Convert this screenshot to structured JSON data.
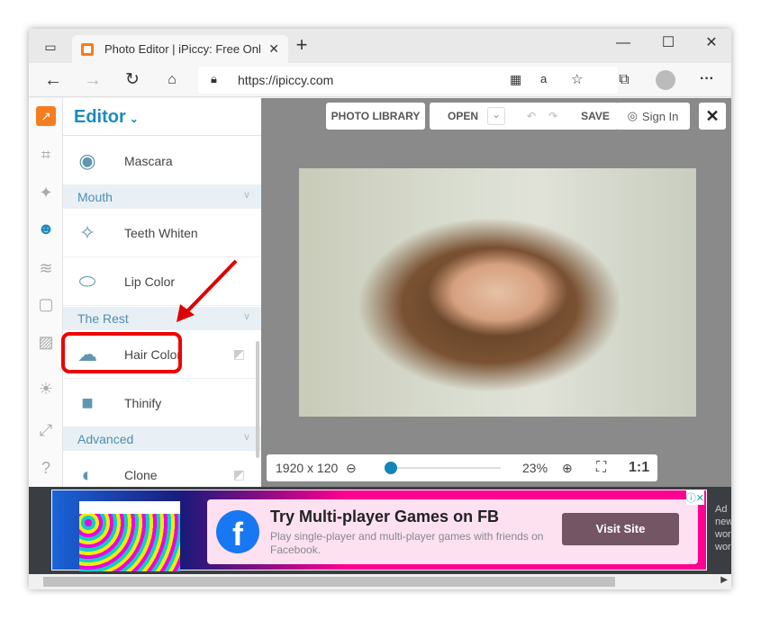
{
  "browser": {
    "tab_title": "Photo Editor | iPiccy: Free Online",
    "url": "https://ipiccy.com"
  },
  "editor": {
    "title": "Editor",
    "items": [
      {
        "type": "item",
        "label": "Mascara",
        "icon": "eye-icon"
      },
      {
        "type": "section",
        "label": "Mouth"
      },
      {
        "type": "item",
        "label": "Teeth Whiten",
        "icon": "tooth-icon"
      },
      {
        "type": "item",
        "label": "Lip Color",
        "icon": "lips-icon"
      },
      {
        "type": "section",
        "label": "The Rest"
      },
      {
        "type": "item",
        "label": "Hair Color",
        "icon": "hair-icon",
        "highlighted": true
      },
      {
        "type": "item",
        "label": "Thinify",
        "icon": "scale-icon"
      },
      {
        "type": "section",
        "label": "Advanced"
      },
      {
        "type": "item",
        "label": "Clone",
        "icon": "clone-icon"
      }
    ]
  },
  "toolbar": {
    "photo_library": "PHOTO LIBRARY",
    "open": "OPEN",
    "save": "SAVE",
    "sign_in": "Sign In"
  },
  "status": {
    "dimensions": "1920 x 120",
    "zoom": "23%",
    "zoom_fraction": 0.1,
    "one_to_one": "1:1"
  },
  "ad": {
    "title": "Try Multi-player Games on FB",
    "body": "Play single-player and multi-player games with friends on Facebook.",
    "cta": "Visit Site",
    "side": [
      "Ad",
      "new",
      "wor",
      "wor"
    ]
  },
  "colors": {
    "accent": "#1b8bbd",
    "highlight": "#e00000"
  }
}
